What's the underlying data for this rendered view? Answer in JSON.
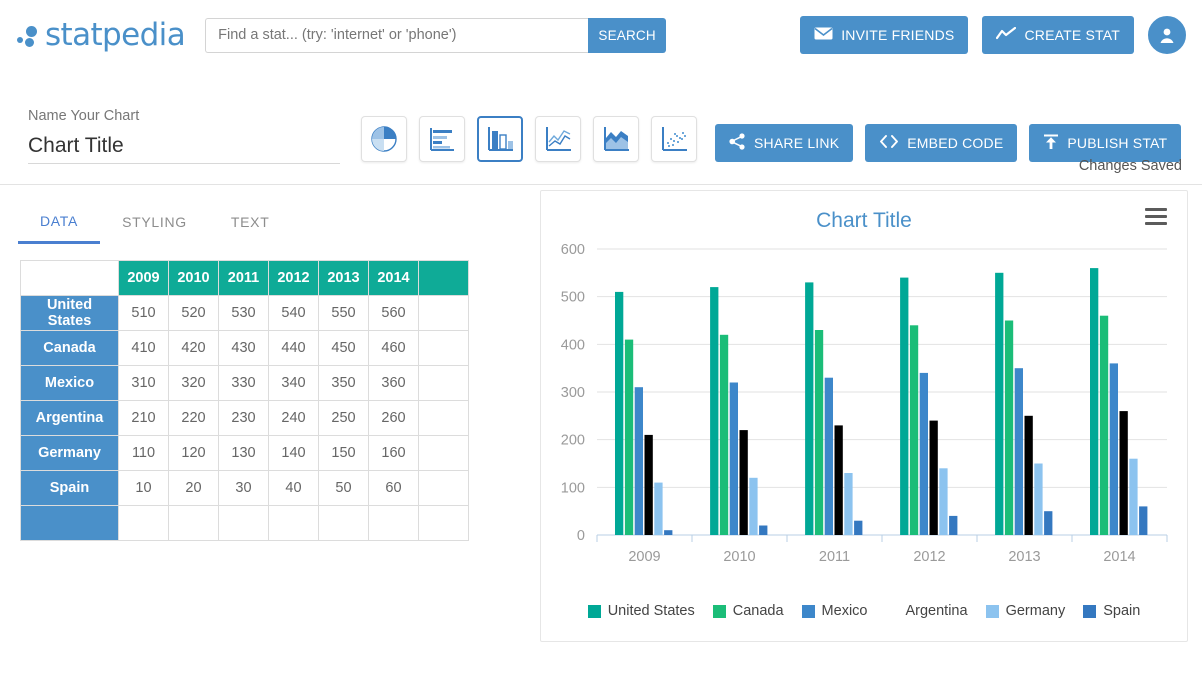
{
  "brand": {
    "name": "statpedia",
    "logo_icon": "scatter-dots-logo"
  },
  "search": {
    "placeholder": "Find a stat... (try: 'internet' or 'phone')",
    "value": "",
    "button_label": "SEARCH",
    "icon": "search-icon"
  },
  "header_actions": {
    "invite_label": "INVITE FRIENDS",
    "invite_icon": "envelope-icon",
    "create_label": "CREATE STAT",
    "create_icon": "line-chart-icon",
    "account_icon": "user-avatar-icon",
    "accent_color": "#4a90c9"
  },
  "chart_header": {
    "name_label": "Name Your Chart",
    "name_value": "Chart Title",
    "saved_status": "Changes Saved",
    "types": [
      {
        "name": "pie-chart-icon",
        "selected": false
      },
      {
        "name": "horizontal-bar-chart-icon",
        "selected": false
      },
      {
        "name": "column-chart-icon",
        "selected": true
      },
      {
        "name": "line-chart-icon",
        "selected": false
      },
      {
        "name": "area-chart-icon",
        "selected": false
      },
      {
        "name": "scatter-chart-icon",
        "selected": false
      }
    ],
    "actions": [
      {
        "label": "SHARE LINK",
        "icon": "share-icon"
      },
      {
        "label": "EMBED CODE",
        "icon": "code-brackets-icon"
      },
      {
        "label": "PUBLISH STAT",
        "icon": "upload-icon"
      }
    ]
  },
  "tabs": [
    {
      "label": "DATA",
      "active": true
    },
    {
      "label": "STYLING",
      "active": false
    },
    {
      "label": "TEXT",
      "active": false
    }
  ],
  "table": {
    "corner": "",
    "columns": [
      "2009",
      "2010",
      "2011",
      "2012",
      "2013",
      "2014",
      ""
    ],
    "rows": [
      {
        "label": "United States",
        "values": [
          "510",
          "520",
          "530",
          "540",
          "550",
          "560",
          ""
        ]
      },
      {
        "label": "Canada",
        "values": [
          "410",
          "420",
          "430",
          "440",
          "450",
          "460",
          ""
        ]
      },
      {
        "label": "Mexico",
        "values": [
          "310",
          "320",
          "330",
          "340",
          "350",
          "360",
          ""
        ]
      },
      {
        "label": "Argentina",
        "values": [
          "210",
          "220",
          "230",
          "240",
          "250",
          "260",
          ""
        ]
      },
      {
        "label": "Germany",
        "values": [
          "110",
          "120",
          "130",
          "140",
          "150",
          "160",
          ""
        ]
      },
      {
        "label": "Spain",
        "values": [
          "10",
          "20",
          "30",
          "40",
          "50",
          "60",
          ""
        ]
      },
      {
        "label": "",
        "values": [
          "",
          "",
          "",
          "",
          "",
          "",
          ""
        ]
      }
    ],
    "header_color": "#0fab97",
    "rowhead_color": "#4a90c9"
  },
  "chart_panel": {
    "title": "Chart Title",
    "menu_icon": "hamburger-menu-icon",
    "title_color": "#4a90c9"
  },
  "chart_data": {
    "type": "bar",
    "title": "Chart Title",
    "xlabel": "",
    "ylabel": "",
    "categories": [
      "2009",
      "2010",
      "2011",
      "2012",
      "2013",
      "2014"
    ],
    "yticks": [
      0,
      100,
      200,
      300,
      400,
      500,
      600
    ],
    "ylim": [
      0,
      600
    ],
    "grid": true,
    "legend_position": "bottom",
    "series": [
      {
        "name": "United States",
        "color": "#00a896",
        "values": [
          510,
          520,
          530,
          540,
          550,
          560
        ]
      },
      {
        "name": "Canada",
        "color": "#1bbd78",
        "values": [
          410,
          420,
          430,
          440,
          450,
          460
        ]
      },
      {
        "name": "Mexico",
        "color": "#3d87ca",
        "values": [
          310,
          320,
          330,
          340,
          350,
          360
        ]
      },
      {
        "name": "Argentina",
        "color": "#67d martinez",
        "values": [
          210,
          220,
          230,
          240,
          250,
          260
        ]
      },
      {
        "name": "Germany",
        "color": "#8cc3ef",
        "values": [
          110,
          120,
          130,
          140,
          150,
          160
        ]
      },
      {
        "name": "Spain",
        "color": "#3478c0",
        "values": [
          10,
          20,
          30,
          40,
          50,
          60
        ]
      }
    ]
  }
}
